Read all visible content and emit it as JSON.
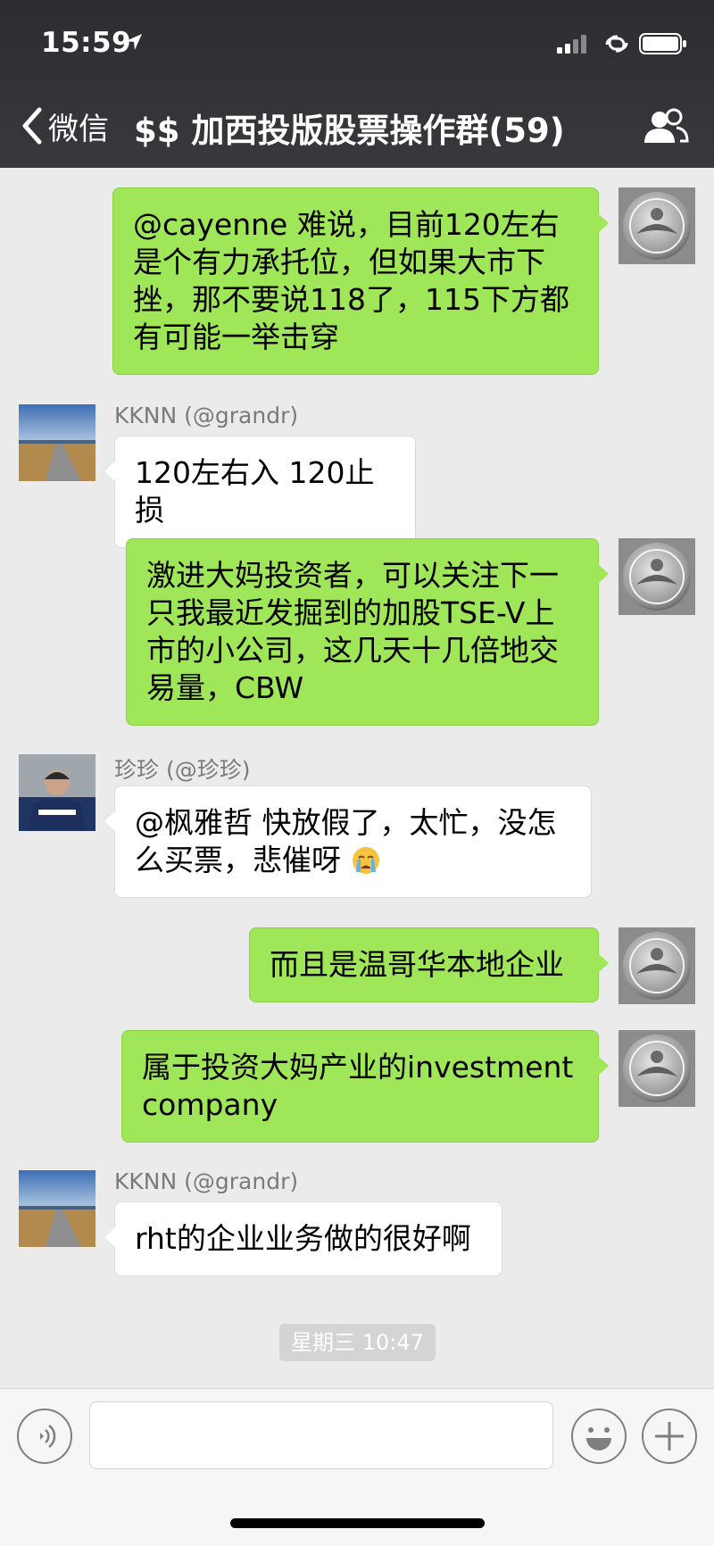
{
  "status_bar": {
    "time": "15:59"
  },
  "nav": {
    "back_label": "微信",
    "title": "$$ 加西投版股票操作群(59)"
  },
  "colors": {
    "header_bg": "#2e2f32",
    "own_bubble": "#9fe658",
    "other_bubble": "#ffffff",
    "chat_bg": "#ebebeb"
  },
  "messages": [
    {
      "side": "right",
      "sender": "",
      "text": "@cayenne 难说，目前120左右是个有力承托位，但如果大市下挫，那不要说118了，115下方都有可能一举击穿"
    },
    {
      "side": "left",
      "sender": "KKNN (@grandr)",
      "text": "120左右入 120止损"
    },
    {
      "side": "right",
      "sender": "",
      "text": "激进大妈投资者，可以关注下一只我最近发掘到的加股TSE-V上市的小公司，这几天十几倍地交易量，CBW"
    },
    {
      "side": "left",
      "sender": "珍珍 (@珍珍)",
      "text": "@枫雅哲 快放假了，太忙，没怎么买票，悲催呀",
      "emoji": "crying-face"
    },
    {
      "side": "right",
      "sender": "",
      "text": "而且是温哥华本地企业"
    },
    {
      "side": "right",
      "sender": "",
      "text": "属于投资大妈产业的investment company"
    },
    {
      "side": "left",
      "sender": "KKNN (@grandr)",
      "text": "rht的企业业务做的很好啊"
    }
  ],
  "timestamp": "星期三 10:47",
  "input": {
    "value": "",
    "placeholder": ""
  }
}
